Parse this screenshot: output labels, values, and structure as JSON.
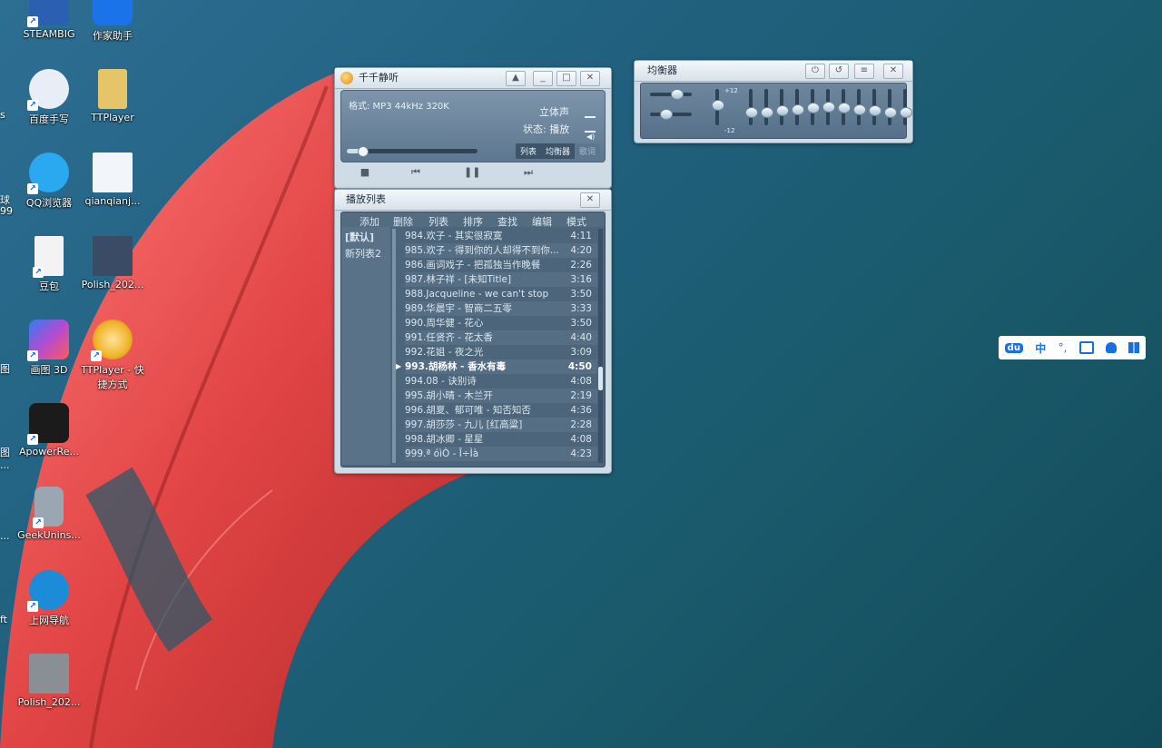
{
  "desktop_icons": [
    {
      "label": "STEAMBIG",
      "color": "#2b5fb2"
    },
    {
      "label": "作家助手",
      "color": "#1a73e8"
    },
    {
      "label": "百度手写",
      "color": "#e8eef6"
    },
    {
      "label": "TTPlayer",
      "color": "#e6c46a"
    },
    {
      "label": "QQ浏览器",
      "color": "#2aa8f0"
    },
    {
      "label": "qianqianj...",
      "color": "#f2f5f9"
    },
    {
      "label": "豆包",
      "color": "#f3f3f3"
    },
    {
      "label": "Polish_202...",
      "color": "#3a4b66"
    },
    {
      "label": "画图 3D",
      "color": "#7b5bd6"
    },
    {
      "label": "TTPlayer - 快捷方式",
      "color": "#f0b429"
    },
    {
      "label": "ApowerRe...",
      "color": "#1b1b1b"
    },
    {
      "label": "GeekUnins...",
      "color": "#9aa7b2"
    },
    {
      "label": "上网导航",
      "color": "#1c8cd8"
    },
    {
      "label": "Polish_202...",
      "color": "#8a8f96"
    }
  ],
  "edge_labels": [
    "s",
    "球",
    "99",
    "图",
    "图",
    "...",
    "...",
    "ft"
  ],
  "player": {
    "title": "千千静听",
    "format": "格式: MP3 44kHz 320K",
    "stereo": "立体声",
    "status": "状态: 播放",
    "tab_list": "列表",
    "tab_eq": "均衡器",
    "tab_lyrics": "歌词",
    "progress": 0.12
  },
  "playlist": {
    "title": "播放列表",
    "menu": [
      "添加",
      "删除",
      "列表",
      "排序",
      "查找",
      "编辑",
      "模式"
    ],
    "lists": [
      "[默认]",
      "新列表2"
    ],
    "tracks": [
      {
        "name": "984.欢子 - 其实很寂寞",
        "time": "4:11"
      },
      {
        "name": "985.欢子 - 得到你的人却得不到你...",
        "time": "4:20"
      },
      {
        "name": "986.画词戏子 - 把孤独当作晚餐",
        "time": "2:26"
      },
      {
        "name": "987.林子祥 - [未知Title]",
        "time": "3:16"
      },
      {
        "name": "988.Jacqueline - we can't stop",
        "time": "3:50"
      },
      {
        "name": "989.华晨宇 - 智商二五零",
        "time": "3:33"
      },
      {
        "name": "990.周华健 - 花心",
        "time": "3:50"
      },
      {
        "name": "991.任贤齐 - 花太香",
        "time": "4:40"
      },
      {
        "name": "992.花姐 - 夜之光",
        "time": "3:09"
      },
      {
        "name": "993.胡杨林 - 香水有毒",
        "time": "4:50"
      },
      {
        "name": "994.08 - 诀别诗",
        "time": "4:08"
      },
      {
        "name": "995.胡小晴 - 木兰开",
        "time": "2:19"
      },
      {
        "name": "996.胡夏、郁可唯 - 知否知否",
        "time": "4:36"
      },
      {
        "name": "997.胡莎莎 - 九儿 [红高粱]",
        "time": "2:28"
      },
      {
        "name": "998.胡冰卿 - 星星",
        "time": "4:08"
      },
      {
        "name": "999.ª óìÒ - Î÷Ìà",
        "time": "4:23"
      }
    ],
    "current_index": 9
  },
  "equalizer": {
    "title": "均衡器",
    "plus_label": "+12",
    "minus_label": "-12",
    "preamp": [
      0.6,
      0.3
    ],
    "bands": [
      0.1,
      0.0,
      0.0,
      0.05,
      0.1,
      0.15,
      0.2,
      0.15,
      0.1,
      0.05,
      0.0,
      0.0
    ]
  },
  "ime_toolbar": {
    "items": [
      "du",
      "中",
      "°,",
      "toolbox",
      "user",
      "grid"
    ]
  },
  "colors": {
    "accent": "#21617f",
    "lcd": "#6a8398",
    "feather": "#e14b4b"
  }
}
